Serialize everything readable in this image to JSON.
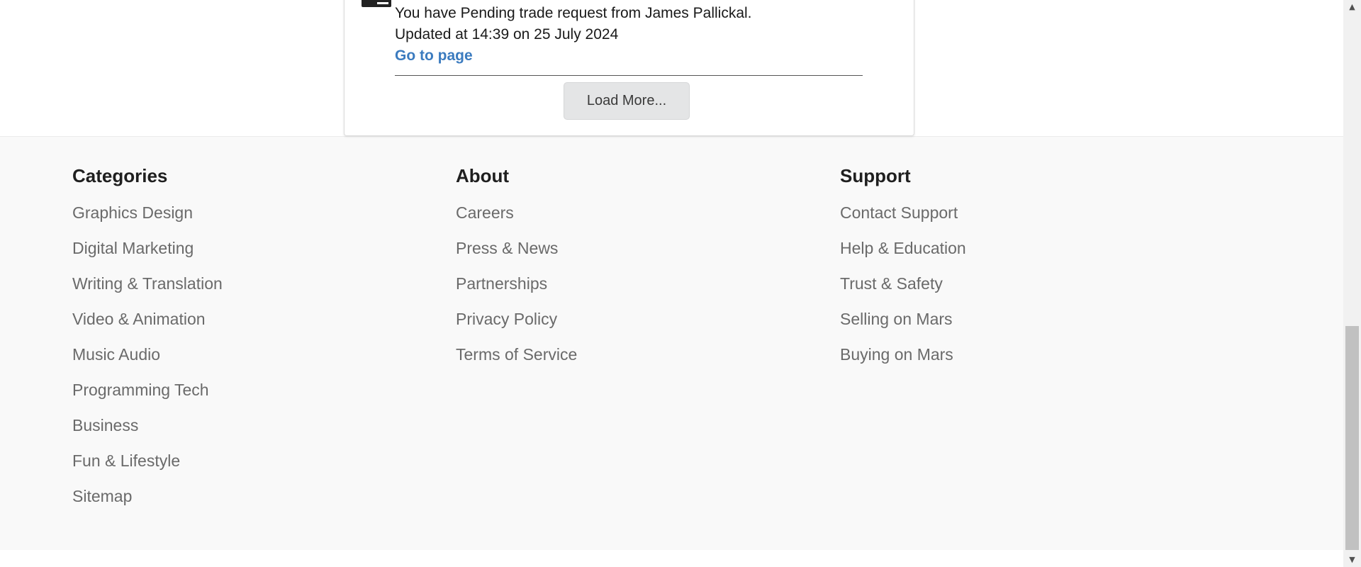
{
  "notification": {
    "message": "You have Pending trade request from James Pallickal.",
    "updated": "Updated at 14:39 on 25 July 2024",
    "link_label": "Go to page",
    "icon": "notification-icon"
  },
  "load_more": {
    "label": "Load More..."
  },
  "footer": {
    "categories": {
      "title": "Categories",
      "items": [
        "Graphics Design",
        "Digital Marketing",
        "Writing & Translation",
        "Video & Animation",
        "Music Audio",
        "Programming Tech",
        "Business",
        "Fun & Lifestyle",
        "Sitemap"
      ]
    },
    "about": {
      "title": "About",
      "items": [
        "Careers",
        "Press & News",
        "Partnerships",
        "Privacy Policy",
        "Terms of Service"
      ]
    },
    "support": {
      "title": "Support",
      "items": [
        "Contact Support",
        "Help & Education",
        "Trust & Safety",
        "Selling on Mars",
        "Buying on Mars"
      ]
    }
  },
  "colors": {
    "link": "#3b7bbf",
    "footer_bg": "#f9f9f9",
    "button_bg": "#e4e5e6"
  },
  "scrollbar": {
    "up_icon": "▲",
    "down_icon": "▼"
  }
}
